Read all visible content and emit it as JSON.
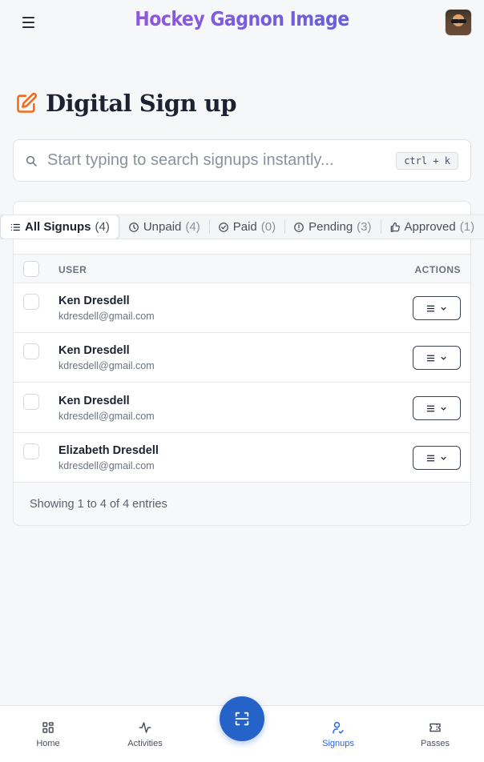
{
  "header": {
    "brand": "Hockey Gagnon Image",
    "menu_icon": "hamburger-menu-icon",
    "avatar": "user-avatar"
  },
  "page": {
    "title": "Digital Sign up",
    "title_icon": "edit-pencil-icon",
    "title_icon_color": "#f26b1d"
  },
  "search": {
    "placeholder": "Start typing to search signups instantly...",
    "value": "",
    "shortcut": "ctrl + k"
  },
  "tabs": [
    {
      "label": "All Signups",
      "count": "(4)",
      "icon": "list-icon",
      "active": true
    },
    {
      "label": "Unpaid",
      "count": "(4)",
      "icon": "clock-icon",
      "active": false
    },
    {
      "label": "Paid",
      "count": "(0)",
      "icon": "check-circle-icon",
      "active": false
    },
    {
      "label": "Pending",
      "count": "(3)",
      "icon": "alert-circle-icon",
      "active": false
    },
    {
      "label": "Approved",
      "count": "(1)",
      "icon": "thumbs-up-icon",
      "active": false
    }
  ],
  "table": {
    "columns": {
      "user": "USER",
      "actions": "ACTIONS"
    },
    "rows": [
      {
        "name": "Ken Dresdell",
        "email": "kdresdell@gmail.com"
      },
      {
        "name": "Ken Dresdell",
        "email": "kdresdell@gmail.com"
      },
      {
        "name": "Ken Dresdell",
        "email": "kdresdell@gmail.com"
      },
      {
        "name": "Elizabeth Dresdell",
        "email": "kdresdell@gmail.com"
      }
    ],
    "footer": "Showing 1 to 4 of 4 entries"
  },
  "bottom_nav": {
    "items": [
      {
        "label": "Home",
        "icon": "grid-icon",
        "active": false
      },
      {
        "label": "Activities",
        "icon": "activity-pulse-icon",
        "active": false
      },
      {
        "label": "Signups",
        "icon": "user-check-icon",
        "active": true
      },
      {
        "label": "Passes",
        "icon": "ticket-icon",
        "active": false
      }
    ],
    "scan_icon": "scan-icon",
    "active_color": "#2563eb",
    "fab_color": "#2563c9"
  }
}
